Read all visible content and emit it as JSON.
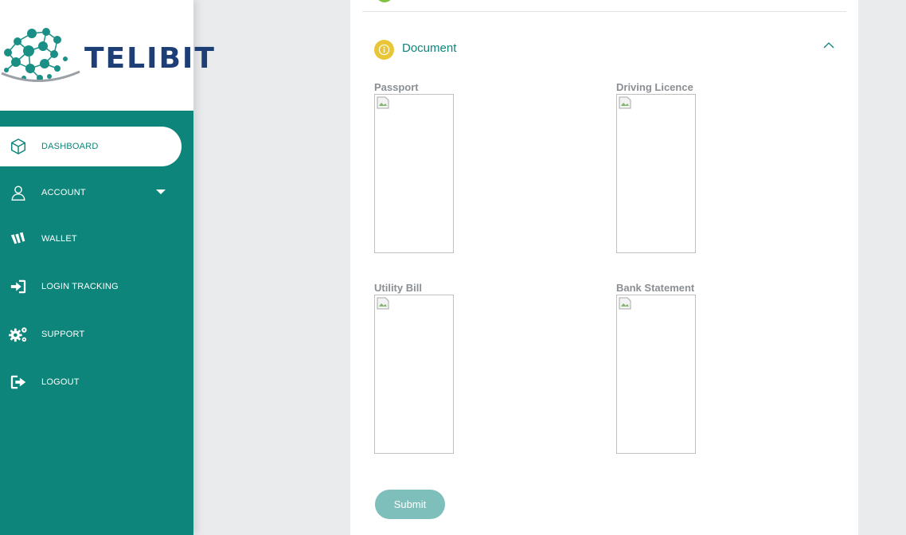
{
  "brand": {
    "name": "TELIBIT"
  },
  "sidebar": {
    "items": [
      {
        "label": "DASHBOARD",
        "icon": "cube-icon",
        "active": true
      },
      {
        "label": "ACCOUNT",
        "icon": "user-icon",
        "has_dropdown": true
      },
      {
        "label": "WALLET",
        "icon": "wallet-icon"
      },
      {
        "label": "LOGIN TRACKING",
        "icon": "sign-in-icon"
      },
      {
        "label": "SUPPORT",
        "icon": "gears-icon"
      },
      {
        "label": "LOGOUT",
        "icon": "sign-out-icon"
      }
    ]
  },
  "document_section": {
    "title": "Document",
    "icon": "info-icon",
    "collapse_icon": "chevron-up-icon",
    "documents": [
      {
        "label": "Passport"
      },
      {
        "label": "Driving Licence"
      },
      {
        "label": "Utility Bill"
      },
      {
        "label": "Bank Statement"
      }
    ],
    "submit_label": "Submit"
  },
  "colors": {
    "sidebar_bg": "#0e857b",
    "accent": "#0e857b",
    "brand_text": "#1e3f76",
    "info_icon": "#e8c637",
    "status_green": "#7fc242",
    "submit_bg": "#7ebfbb",
    "page_bg": "#eaebed"
  }
}
